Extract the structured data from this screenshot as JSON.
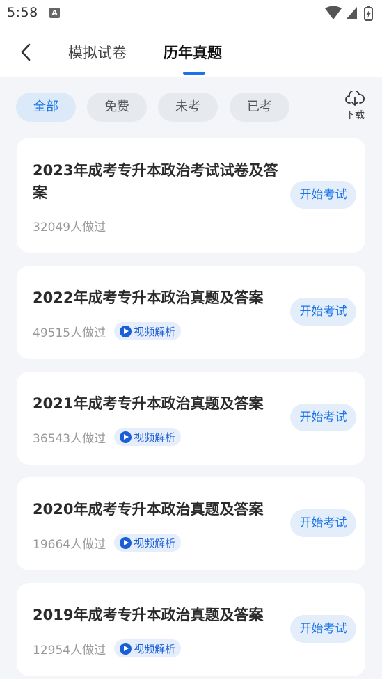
{
  "status_bar": {
    "time": "5:58",
    "notification": "A"
  },
  "nav": {
    "tabs": [
      {
        "label": "模拟试卷",
        "active": false
      },
      {
        "label": "历年真题",
        "active": true
      }
    ]
  },
  "filters": {
    "chips": [
      {
        "label": "全部",
        "active": true
      },
      {
        "label": "免费",
        "active": false
      },
      {
        "label": "未考",
        "active": false
      },
      {
        "label": "已考",
        "active": false
      }
    ],
    "download_label": "下载"
  },
  "papers": [
    {
      "title": "2023年成考专升本政治考试试卷及答案",
      "count": "32049人做过",
      "has_video": false,
      "video_label": "",
      "button": "开始考试"
    },
    {
      "title": "2022年成考专升本政治真题及答案",
      "count": "49515人做过",
      "has_video": true,
      "video_label": "视频解析",
      "button": "开始考试"
    },
    {
      "title": "2021年成考专升本政治真题及答案",
      "count": "36543人做过",
      "has_video": true,
      "video_label": "视频解析",
      "button": "开始考试"
    },
    {
      "title": "2020年成考专升本政治真题及答案",
      "count": "19664人做过",
      "has_video": true,
      "video_label": "视频解析",
      "button": "开始考试"
    },
    {
      "title": "2019年成考专升本政治真题及答案",
      "count": "12954人做过",
      "has_video": true,
      "video_label": "视频解析",
      "button": "开始考试"
    }
  ],
  "colors": {
    "accent": "#1a73e8",
    "background": "#f3f5f9",
    "card": "#ffffff"
  }
}
